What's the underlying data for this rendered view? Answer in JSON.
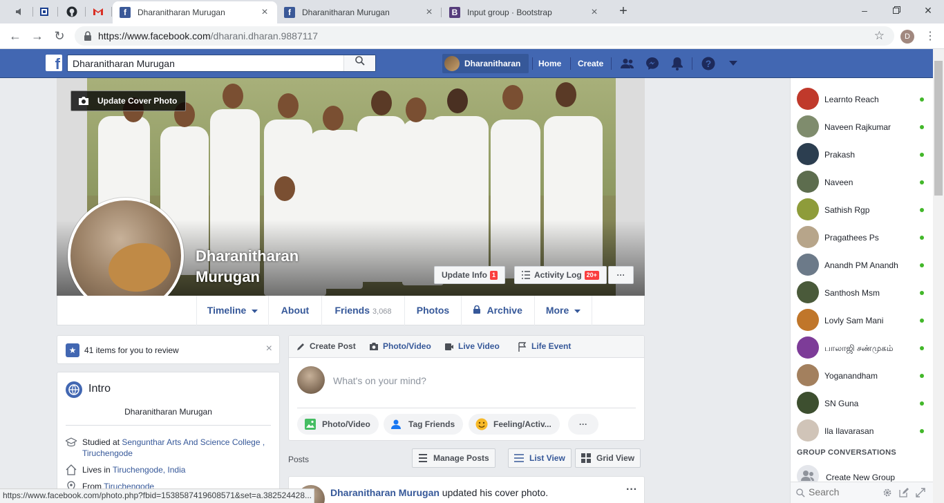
{
  "browser": {
    "pinned_tabs": [
      "speaker-tab",
      "site-tab",
      "github-tab",
      "gmail-tab"
    ],
    "tabs": [
      {
        "title": "Dharanitharan Murugan",
        "favicon": "facebook",
        "active": true
      },
      {
        "title": "Dharanitharan Murugan",
        "favicon": "facebook",
        "active": false
      },
      {
        "title": "Input group · Bootstrap",
        "favicon": "bootstrap",
        "active": false
      }
    ],
    "url_host": "https://www.facebook.com",
    "url_path": "/dharani.dharan.9887117",
    "profile_initial": "D",
    "status_url": "https://www.facebook.com/photo.php?fbid=1538587419608571&set=a.382524428..."
  },
  "fb": {
    "search_value": "Dharanitharan Murugan",
    "nav": {
      "user": "Dharanitharan",
      "home": "Home",
      "create": "Create"
    },
    "brand_color": "#4267b2"
  },
  "profile": {
    "update_cover": "Update Cover Photo",
    "name_line1": "Dharanitharan",
    "name_line2": "Murugan",
    "update_info": "Update Info",
    "update_info_badge": "1",
    "activity_log": "Activity Log",
    "activity_badge": "20+",
    "more_dots": "···",
    "tabs": {
      "timeline": "Timeline",
      "about": "About",
      "friends": "Friends",
      "friends_count": "3,068",
      "photos": "Photos",
      "archive": "Archive",
      "more": "More"
    }
  },
  "review": {
    "text": "41 items for you to review",
    "close": "×"
  },
  "intro": {
    "title": "Intro",
    "bio": "Dharanitharan Murugan",
    "studied_prefix": "Studied at ",
    "studied_link": "Sengunthar Arts And Science College , Tiruchengode",
    "lives_prefix": "Lives in ",
    "lives_link": "Tiruchengode, India",
    "from_prefix": "From ",
    "from_link": "Tiruchengode"
  },
  "composer": {
    "tabs": {
      "create": "Create Post",
      "photo": "Photo/Video",
      "live": "Live Video",
      "life": "Life Event"
    },
    "placeholder": "What's on your mind?",
    "actions": {
      "photo": "Photo/Video",
      "tag": "Tag Friends",
      "feeling": "Feeling/Activ...",
      "more": "···"
    }
  },
  "posts": {
    "label": "Posts",
    "manage": "Manage Posts",
    "list_view": "List View",
    "grid_view": "Grid View",
    "first_author": "Dharanitharan Murugan",
    "first_action": "updated his cover photo.",
    "more": "···"
  },
  "chat": {
    "friends": [
      {
        "name": "Learnto Reach",
        "color": "#c0392b"
      },
      {
        "name": "Naveen Rajkumar",
        "color": "#7f8c6d"
      },
      {
        "name": "Prakash",
        "color": "#2c3e50"
      },
      {
        "name": "Naveen",
        "color": "#5d6d4e"
      },
      {
        "name": "Sathish Rgp",
        "color": "#8e9c3a"
      },
      {
        "name": "Pragathees Ps",
        "color": "#b7a58a"
      },
      {
        "name": "Anandh PM Anandh",
        "color": "#6c7a89"
      },
      {
        "name": "Santhosh Msm",
        "color": "#4a5a3a"
      },
      {
        "name": "Lovly Sam Mani",
        "color": "#c0762a"
      },
      {
        "name": "பாலாஜி சண்முகம்",
        "color": "#7d3c98"
      },
      {
        "name": "Yoganandham",
        "color": "#a3805e"
      },
      {
        "name": "SN Guna",
        "color": "#3d4f2f"
      },
      {
        "name": "Ila Ilavarasan",
        "color": "#d0c4b8"
      }
    ],
    "online_color": "#42b72a",
    "group_header": "GROUP CONVERSATIONS",
    "new_group": "Create New Group",
    "search_placeholder": "Search"
  }
}
